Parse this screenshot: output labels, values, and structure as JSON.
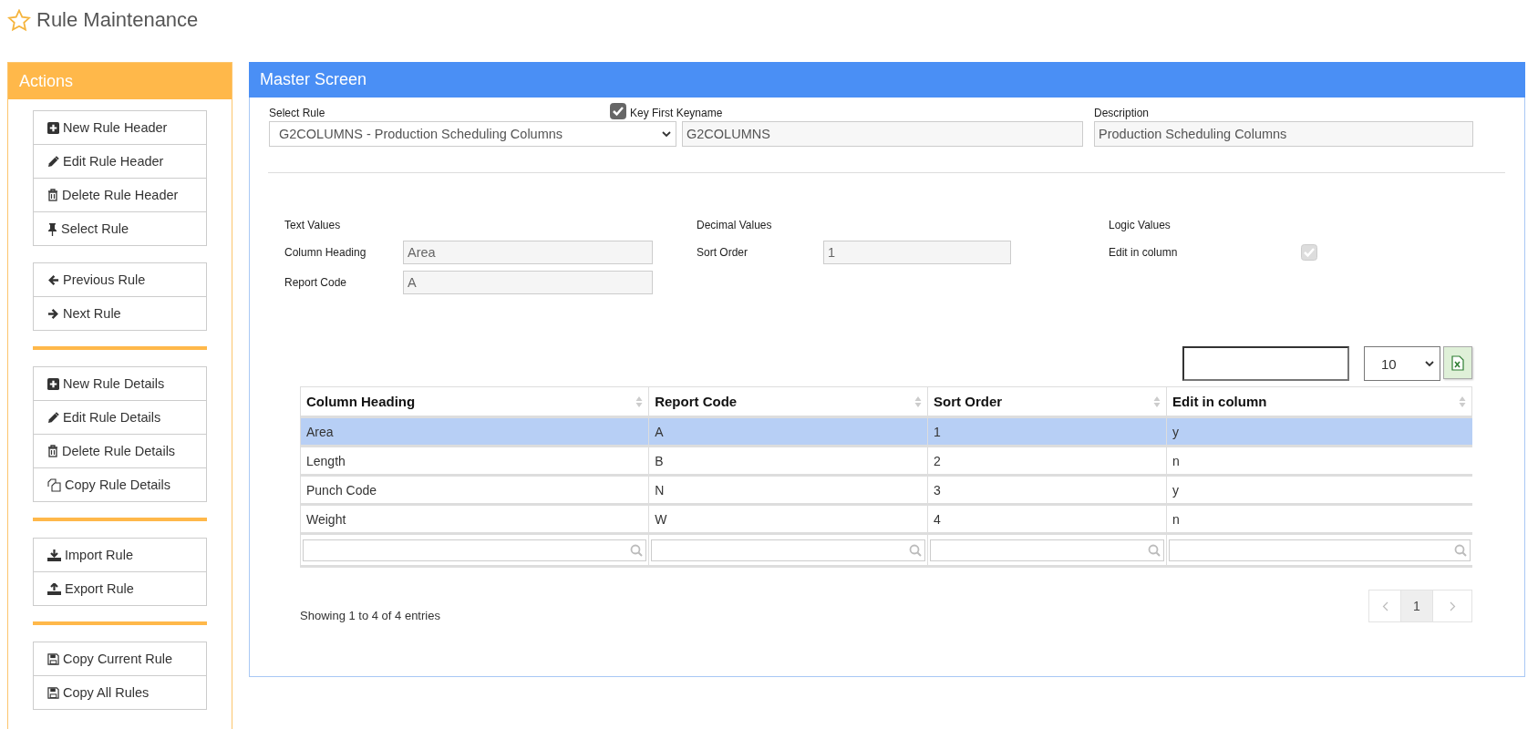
{
  "page": {
    "title": "Rule Maintenance"
  },
  "actions": {
    "title": "Actions",
    "groups": [
      {
        "divider_before": false,
        "buttons": [
          {
            "label": "New Rule Header",
            "kind": "add"
          },
          {
            "label": "Edit Rule Header",
            "kind": "edit"
          },
          {
            "label": "Delete Rule Header",
            "kind": "delete"
          },
          {
            "label": "Select Rule",
            "kind": "select"
          }
        ]
      },
      {
        "divider_before": false,
        "buttons": [
          {
            "label": "Previous Rule",
            "kind": "previous"
          },
          {
            "label": "Next Rule",
            "kind": "next"
          }
        ]
      },
      {
        "divider_before": true,
        "buttons": [
          {
            "label": "New Rule Details",
            "kind": "add"
          },
          {
            "label": "Edit Rule Details",
            "kind": "edit"
          },
          {
            "label": "Delete Rule Details",
            "kind": "delete"
          },
          {
            "label": "Copy Rule Details",
            "kind": "copy"
          }
        ]
      },
      {
        "divider_before": true,
        "buttons": [
          {
            "label": "Import Rule",
            "kind": "import"
          },
          {
            "label": "Export Rule",
            "kind": "export"
          }
        ]
      },
      {
        "divider_before": true,
        "buttons": [
          {
            "label": "Copy Current Rule",
            "kind": "save"
          },
          {
            "label": "Copy All Rules",
            "kind": "save"
          }
        ]
      }
    ]
  },
  "master": {
    "title": "Master Screen",
    "select_rule": {
      "label": "Select Rule",
      "value": "G2COLUMNS - Production Scheduling Columns"
    },
    "key_first": {
      "label": "Key First Keyname",
      "checked": true,
      "value": "G2COLUMNS"
    },
    "description": {
      "label": "Description",
      "value": "Production Scheduling Columns"
    },
    "sections": [
      {
        "title": "Text Values",
        "fields": [
          {
            "kind": "text",
            "label": "Column Heading",
            "value": "Area"
          },
          {
            "kind": "text",
            "label": "Report Code",
            "value": "A"
          }
        ]
      },
      {
        "title": "Decimal Values",
        "fields": [
          {
            "kind": "text",
            "label": "Sort Order",
            "value": "1"
          }
        ]
      },
      {
        "title": "Logic Values",
        "fields": [
          {
            "kind": "checkbox",
            "label": "Edit in column",
            "checked": true,
            "disabled": true
          }
        ]
      }
    ],
    "table": {
      "page_size": "10",
      "columns": [
        "Column Heading",
        "Report Code",
        "Sort Order",
        "Edit in column"
      ],
      "rows": [
        {
          "selected": true,
          "cells": [
            "Area",
            "A",
            "1",
            "y"
          ]
        },
        {
          "selected": false,
          "cells": [
            "Length",
            "B",
            "2",
            "n"
          ]
        },
        {
          "selected": false,
          "cells": [
            "Punch Code",
            "N",
            "3",
            "y"
          ]
        },
        {
          "selected": false,
          "cells": [
            "Weight",
            "W",
            "4",
            "n"
          ]
        }
      ],
      "info": "Showing 1 to 4 of 4 entries",
      "pages": [
        {
          "label": "1",
          "selected": true
        }
      ]
    }
  }
}
